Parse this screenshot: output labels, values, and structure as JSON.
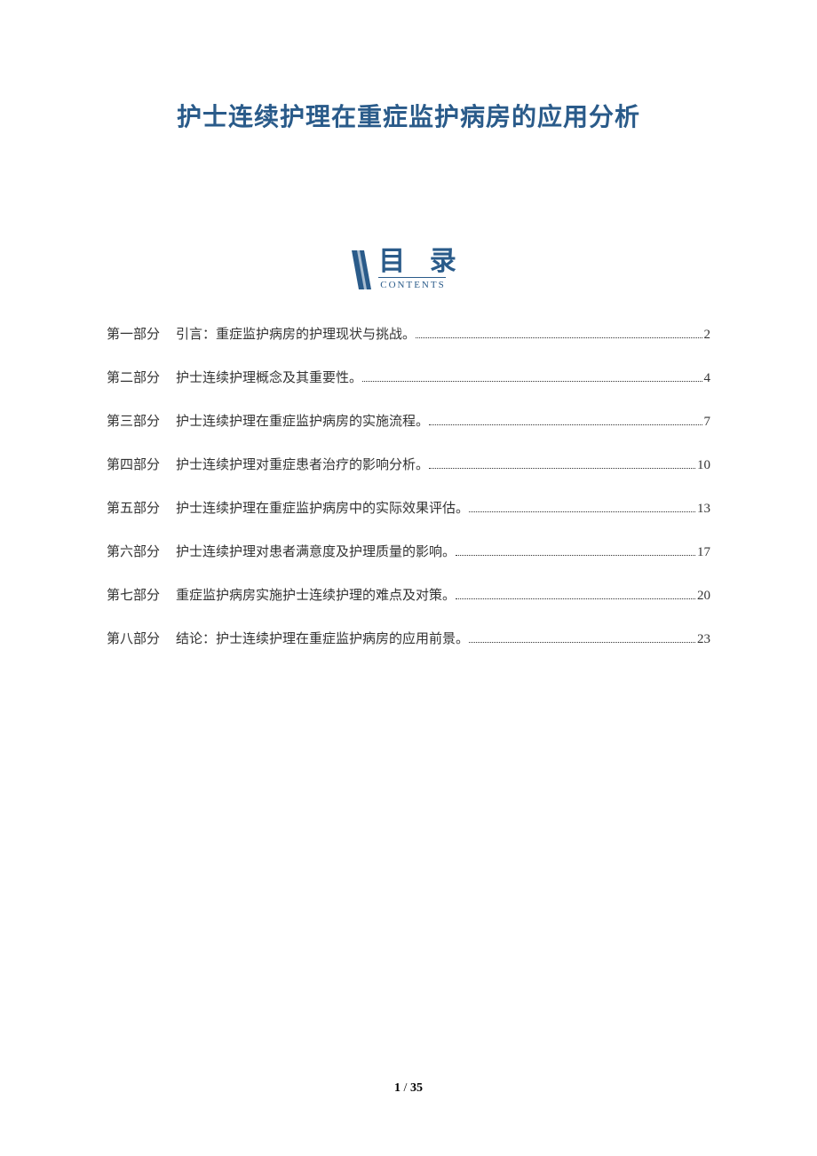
{
  "title": "护士连续护理在重症监护病房的应用分析",
  "toc": {
    "label": "目 录",
    "sublabel": "CONTENTS",
    "items": [
      {
        "part": "第一部分",
        "title": "引言：重症监护病房的护理现状与挑战。",
        "page": "2"
      },
      {
        "part": "第二部分",
        "title": "护士连续护理概念及其重要性。",
        "page": "4"
      },
      {
        "part": "第三部分",
        "title": "护士连续护理在重症监护病房的实施流程。",
        "page": "7"
      },
      {
        "part": "第四部分",
        "title": "护士连续护理对重症患者治疗的影响分析。",
        "page": "10"
      },
      {
        "part": "第五部分",
        "title": "护士连续护理在重症监护病房中的实际效果评估。",
        "page": "13"
      },
      {
        "part": "第六部分",
        "title": "护士连续护理对患者满意度及护理质量的影响。",
        "page": "17"
      },
      {
        "part": "第七部分",
        "title": "重症监护病房实施护士连续护理的难点及对策。",
        "page": "20"
      },
      {
        "part": "第八部分",
        "title": "结论：护士连续护理在重症监护病房的应用前景。",
        "page": "23"
      }
    ]
  },
  "footer": {
    "current": "1",
    "sep": " / ",
    "total": "35"
  }
}
